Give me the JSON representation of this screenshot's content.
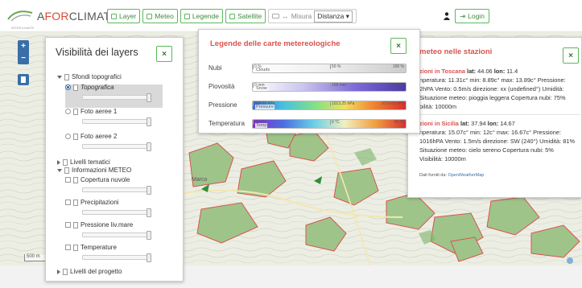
{
  "app": {
    "logo_prefix": "A",
    "logo_accent": "FOR",
    "logo_suffix": "CLIMATE",
    "logo_sub": "AFORCLIMATE"
  },
  "toolbar": {
    "layer": "Layer",
    "meteo": "Meteo",
    "legende": "Legende",
    "satellite": "Satellite",
    "misura_label": "Misura",
    "misura_value": "Distanza ▾",
    "login": "Login"
  },
  "map": {
    "place_label": "Marco",
    "scale_label": "500 m"
  },
  "layers_panel": {
    "title": "Visibilità dei layers",
    "close": "×",
    "sfondi": "Sfondi topografici",
    "topografica": "Topografica",
    "foto1": "Foto aeree 1",
    "foto2": "Foto aeree 2",
    "tematici": "Livelli tematici",
    "meteo": "Informazioni METEO",
    "copertura": "Copertura nuvole",
    "precipitazioni": "Precipitazioni",
    "pressione": "Pressione liv.mare",
    "temperature": "Temperature",
    "progetto": "Livelli del progetto"
  },
  "legend_panel": {
    "title": "Legende delle carte metereologiche",
    "close": "×",
    "rows": [
      {
        "label": "Nubi",
        "name": "Clouds",
        "ticks": [
          "0 %",
          "50 %",
          "100 %"
        ]
      },
      {
        "label": "Piovosità",
        "name": "Snow",
        "ticks": [
          "0 mm",
          "100 mm",
          "200 mm"
        ]
      },
      {
        "label": "Pressione",
        "name": "Pressure",
        "ticks": [
          "949.92 hPa",
          "1013.25 hPa",
          "1070.63 hPa"
        ]
      },
      {
        "label": "Temperatura",
        "name": "Temp",
        "ticks": [
          "-40 °C",
          "0 °C",
          "40 °C"
        ]
      }
    ]
  },
  "stations_panel": {
    "title": "meteo nelle stazioni",
    "close": "×",
    "toscana": {
      "head": "zioni in Toscana",
      "lat_l": "lat:",
      "lat": "44.06",
      "lon_l": "lon:",
      "lon": "11.4",
      "line2": "nperatura: 11.31c° min: 8.89c° max: 13.89c° Pressione:",
      "line3": "2hPA Vento: 0.5m/s direzione: xx (undefined°) Umidità:",
      "line4": "Situazione meteo: pioggia leggera Copertura nubi: 75%",
      "line5": "bilità: 10000m"
    },
    "sicilia": {
      "head": "zioni in Sicilia",
      "lat_l": "lat:",
      "lat": "37.94",
      "lon_l": "lon:",
      "lon": "14.67",
      "line2": "nperatura: 15.07c° min: 12c° max: 16.67c° Pressione:",
      "line3": "1016hPA Vento: 1.5m/s direzione: SW (240°) Umidità: 81%",
      "line4": "Situazione meteo: cielo sereno Copertura nubi: 5%",
      "line5": "Visibilità: 10000m"
    },
    "credit_prefix": "Dati forniti da:",
    "credit_link": "OpenWeatherMap"
  },
  "colors": {
    "accent_green": "#5cb85c",
    "title_red": "#d9534f",
    "control_blue": "#3a6ea8"
  }
}
